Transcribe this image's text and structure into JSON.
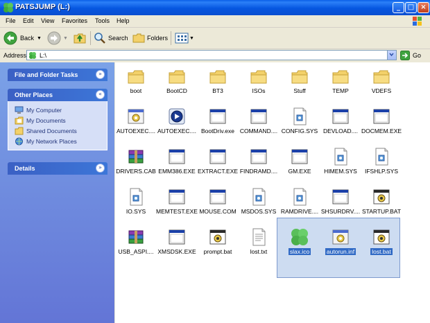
{
  "window": {
    "title": "PATSJUMP (L:)"
  },
  "menubar": [
    "File",
    "Edit",
    "View",
    "Favorites",
    "Tools",
    "Help"
  ],
  "toolbar": {
    "back_label": "Back",
    "search_label": "Search",
    "folders_label": "Folders"
  },
  "address": {
    "label": "Address",
    "value": "L:\\",
    "go_label": "Go"
  },
  "left_pane": {
    "file_tasks": {
      "title": "File and Folder Tasks"
    },
    "other_places": {
      "title": "Other Places",
      "items": [
        "My Computer",
        "My Documents",
        "Shared Documents",
        "My Network Places"
      ]
    },
    "details": {
      "title": "Details"
    }
  },
  "files": [
    {
      "label": "boot",
      "icon": "folder-icon"
    },
    {
      "label": "BootCD",
      "icon": "folder-icon"
    },
    {
      "label": "BT3",
      "icon": "folder-icon"
    },
    {
      "label": "ISOs",
      "icon": "folder-icon"
    },
    {
      "label": "Stuff",
      "icon": "folder-icon"
    },
    {
      "label": "TEMP",
      "icon": "folder-icon"
    },
    {
      "label": "VDEFS",
      "icon": "folder-icon"
    },
    {
      "label": "AUTOEXEC....",
      "icon": "settings-file-icon"
    },
    {
      "label": "AUTOEXEC....",
      "icon": "media-icon"
    },
    {
      "label": "BootDriv.exe",
      "icon": "exe-window-icon"
    },
    {
      "label": "COMMAND....",
      "icon": "exe-window-icon"
    },
    {
      "label": "CONFIG.SYS",
      "icon": "sys-file-icon"
    },
    {
      "label": "DEVLOAD....",
      "icon": "exe-window-icon"
    },
    {
      "label": "DOCMEM.EXE",
      "icon": "exe-window-icon"
    },
    {
      "label": "DRIVERS.CAB",
      "icon": "archive-icon"
    },
    {
      "label": "EMM386.EXE",
      "icon": "exe-window-icon"
    },
    {
      "label": "EXTRACT.EXE",
      "icon": "exe-window-icon"
    },
    {
      "label": "FINDRAMD....",
      "icon": "exe-window-icon"
    },
    {
      "label": "GM.EXE",
      "icon": "exe-window-icon"
    },
    {
      "label": "HIMEM.SYS",
      "icon": "sys-file-icon"
    },
    {
      "label": "IFSHLP.SYS",
      "icon": "sys-file-icon"
    },
    {
      "label": "IO.SYS",
      "icon": "sys-file-icon"
    },
    {
      "label": "MEMTEST.EXE",
      "icon": "exe-window-icon"
    },
    {
      "label": "MOUSE.COM",
      "icon": "exe-window-icon"
    },
    {
      "label": "MSDOS.SYS",
      "icon": "sys-file-icon"
    },
    {
      "label": "RAMDRIVE....",
      "icon": "sys-file-icon"
    },
    {
      "label": "SHSURDRV....",
      "icon": "exe-window-icon"
    },
    {
      "label": "STARTUP.BAT",
      "icon": "batch-file-icon"
    },
    {
      "label": "USB_ASPI....",
      "icon": "archive-icon"
    },
    {
      "label": "XMSDSK.EXE",
      "icon": "exe-window-icon"
    },
    {
      "label": "prompt.bat",
      "icon": "batch-file-icon"
    },
    {
      "label": "lost.txt",
      "icon": "text-file-icon"
    },
    {
      "label": "slax.ico",
      "icon": "clover-icon",
      "selected": true
    },
    {
      "label": "autorun.inf",
      "icon": "settings-file-icon",
      "selected": true
    },
    {
      "label": "lost.bat",
      "icon": "batch-file-icon",
      "selected": true
    }
  ]
}
